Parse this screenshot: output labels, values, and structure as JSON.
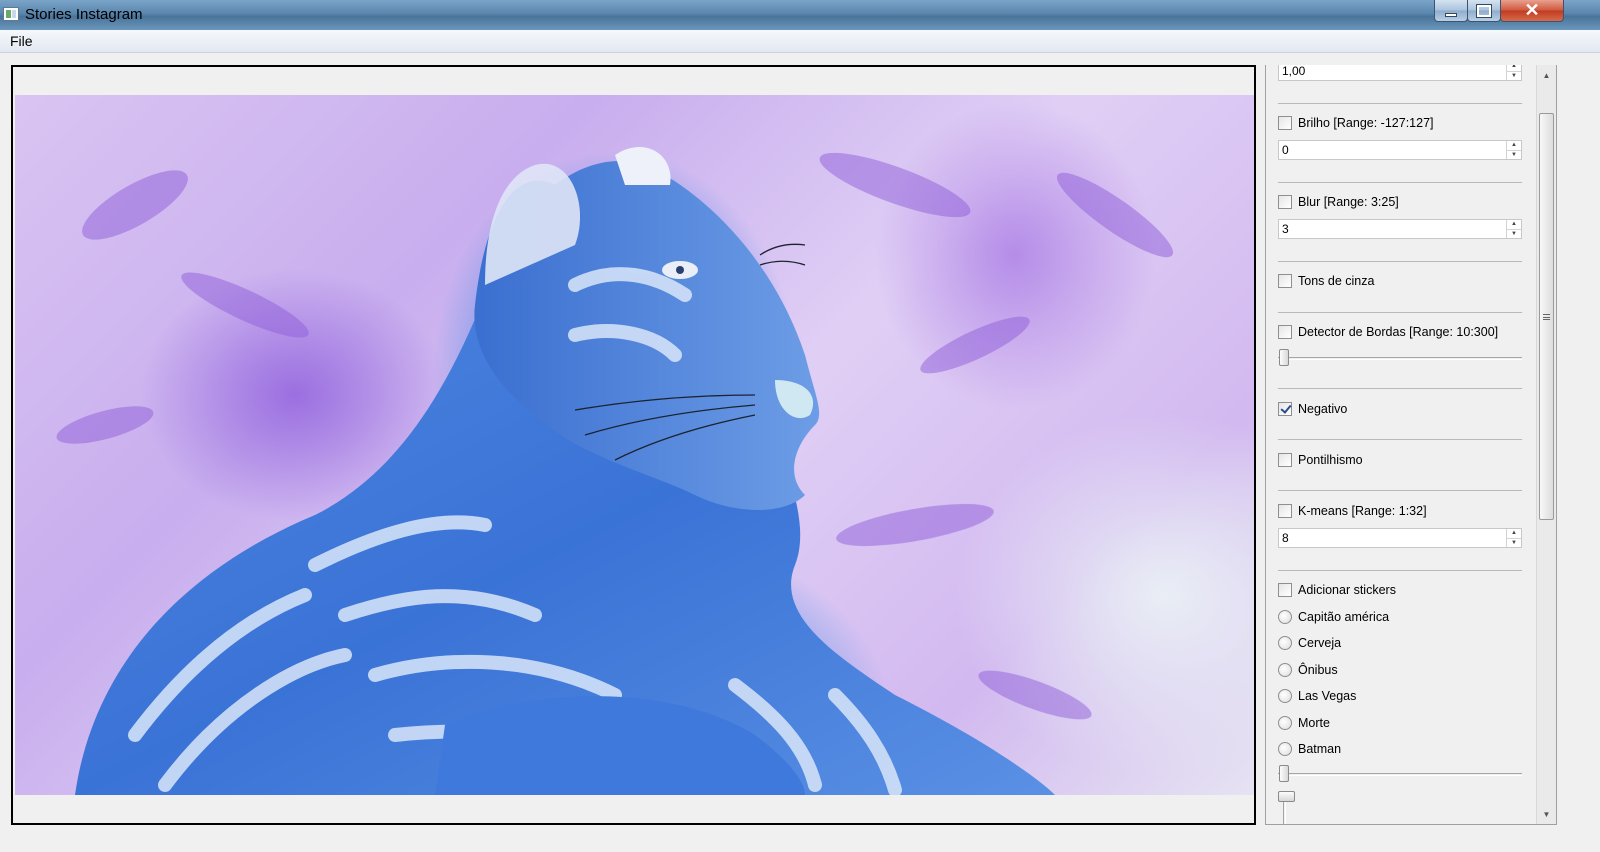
{
  "window": {
    "title": "Stories Instagram"
  },
  "menu": {
    "file": "File"
  },
  "controls": {
    "top_spin_value": "1,00",
    "brilho_label": "Brilho [Range: -127:127]",
    "brilho_value": "0",
    "blur_label": "Blur [Range: 3:25]",
    "blur_value": "3",
    "tons_label": "Tons de cinza",
    "bordas_label": "Detector de Bordas [Range: 10:300]",
    "negativo_label": "Negativo",
    "pontilhismo_label": "Pontilhismo",
    "kmeans_label": "K-means [Range: 1:32]",
    "kmeans_value": "8",
    "stickers_label": "Adicionar stickers",
    "stickers": [
      "Capitão américa",
      "Cerveja",
      "Ônibus",
      "Las Vegas",
      "Morte",
      "Batman"
    ]
  },
  "state": {
    "negativo_checked": true
  },
  "colors": {
    "titlebar": "#5b86ad",
    "close": "#c13b20",
    "check": "#2b4a8a"
  },
  "icons": [
    "app-icon",
    "minimize-icon",
    "maximize-icon",
    "close-icon",
    "spin-up-icon",
    "spin-down-icon",
    "scroll-up-icon",
    "scroll-down-icon",
    "scroll-grip-icon",
    "checkmark-icon"
  ]
}
